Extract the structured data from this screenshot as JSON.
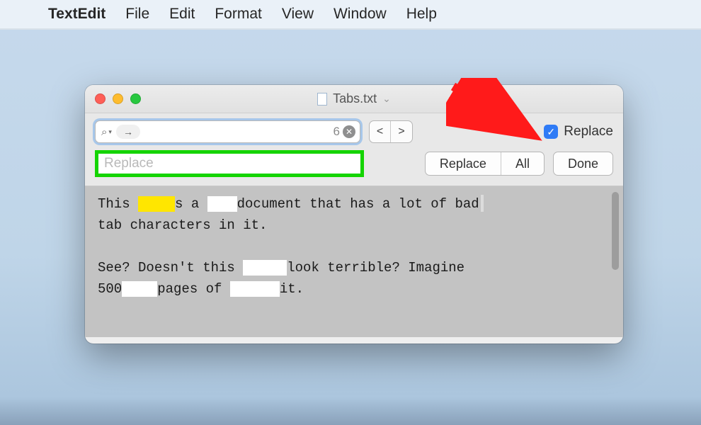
{
  "menubar": {
    "appname": "TextEdit",
    "items": [
      "File",
      "Edit",
      "Format",
      "View",
      "Window",
      "Help"
    ]
  },
  "window": {
    "title": "Tabs.txt"
  },
  "findbar": {
    "search_value": "",
    "result_count": "6",
    "prev_label": "<",
    "next_label": ">",
    "replace_checkbox_label": "Replace",
    "replace_placeholder": "Replace",
    "replace_value": "",
    "replace_btn": "Replace",
    "all_btn": "All",
    "done_btn": "Done"
  },
  "document": {
    "line1a": "This ",
    "line1b": "s a ",
    "line1c": "document that has a lot of bad",
    "line2": "tab characters in it.",
    "line3a": "See? Doesn't this ",
    "line3b": "look terrible? Imagine",
    "line4a": "500",
    "line4b": "pages of ",
    "line4c": "it."
  }
}
